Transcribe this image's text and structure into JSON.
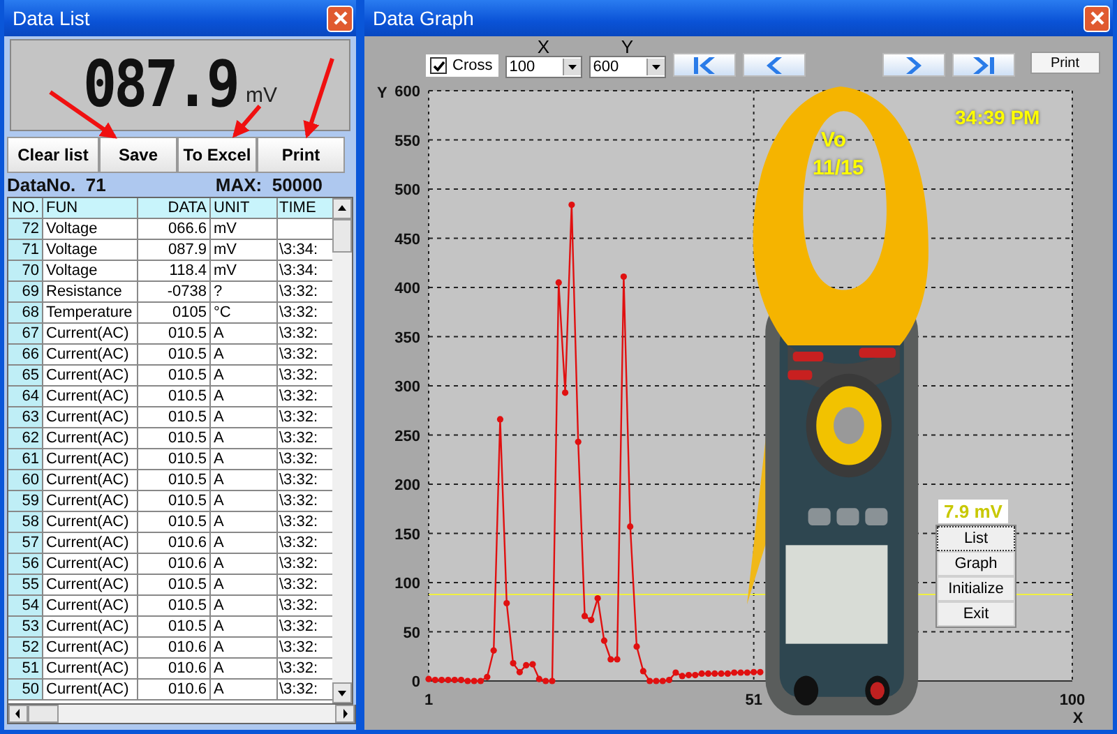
{
  "data_list": {
    "title": "Data List",
    "display": {
      "reading": "087.9",
      "unit": "mV"
    },
    "buttons": [
      "Clear list",
      "Save",
      "To Excel",
      "Print"
    ],
    "data_no_label": "DataNo.",
    "data_no": "71",
    "max_label": "MAX:",
    "max": "50000",
    "table": {
      "columns": [
        "NO.",
        "FUN",
        "DATA",
        "UNIT",
        "TIME"
      ],
      "rows": [
        {
          "no": "72",
          "fun": "Voltage",
          "data": "066.6",
          "unit": "mV"
        },
        {
          "no": "71",
          "fun": "Voltage",
          "data": "087.9",
          "unit": "mV",
          "time": "\\3:34:"
        },
        {
          "no": "70",
          "fun": "Voltage",
          "data": "118.4",
          "unit": "mV",
          "time": "\\3:34:"
        },
        {
          "no": "69",
          "fun": "Resistance",
          "data": "-0738",
          "unit": "?",
          "time": "\\3:32:"
        },
        {
          "no": "68",
          "fun": "Temperature",
          "data": "0105",
          "unit": "°C",
          "time": "\\3:32:"
        },
        {
          "no": "67",
          "fun": "Current(AC)",
          "data": "010.5",
          "unit": "A",
          "time": "\\3:32:"
        },
        {
          "no": "66",
          "fun": "Current(AC)",
          "data": "010.5",
          "unit": "A",
          "time": "\\3:32:"
        },
        {
          "no": "65",
          "fun": "Current(AC)",
          "data": "010.5",
          "unit": "A",
          "time": "\\3:32:"
        },
        {
          "no": "64",
          "fun": "Current(AC)",
          "data": "010.5",
          "unit": "A",
          "time": "\\3:32:"
        },
        {
          "no": "63",
          "fun": "Current(AC)",
          "data": "010.5",
          "unit": "A",
          "time": "\\3:32:"
        },
        {
          "no": "62",
          "fun": "Current(AC)",
          "data": "010.5",
          "unit": "A",
          "time": "\\3:32:"
        },
        {
          "no": "61",
          "fun": "Current(AC)",
          "data": "010.5",
          "unit": "A",
          "time": "\\3:32:"
        },
        {
          "no": "60",
          "fun": "Current(AC)",
          "data": "010.5",
          "unit": "A",
          "time": "\\3:32:"
        },
        {
          "no": "59",
          "fun": "Current(AC)",
          "data": "010.5",
          "unit": "A",
          "time": "\\3:32:"
        },
        {
          "no": "58",
          "fun": "Current(AC)",
          "data": "010.5",
          "unit": "A",
          "time": "\\3:32:"
        },
        {
          "no": "57",
          "fun": "Current(AC)",
          "data": "010.6",
          "unit": "A",
          "time": "\\3:32:"
        },
        {
          "no": "56",
          "fun": "Current(AC)",
          "data": "010.6",
          "unit": "A",
          "time": "\\3:32:"
        },
        {
          "no": "55",
          "fun": "Current(AC)",
          "data": "010.5",
          "unit": "A",
          "time": "\\3:32:"
        },
        {
          "no": "54",
          "fun": "Current(AC)",
          "data": "010.5",
          "unit": "A",
          "time": "\\3:32:"
        },
        {
          "no": "53",
          "fun": "Current(AC)",
          "data": "010.5",
          "unit": "A",
          "time": "\\3:32:"
        },
        {
          "no": "52",
          "fun": "Current(AC)",
          "data": "010.6",
          "unit": "A",
          "time": "\\3:32:"
        },
        {
          "no": "51",
          "fun": "Current(AC)",
          "data": "010.6",
          "unit": "A",
          "time": "\\3:32:"
        },
        {
          "no": "50",
          "fun": "Current(AC)",
          "data": "010.6",
          "unit": "A",
          "time": "\\3:32:"
        }
      ]
    }
  },
  "data_graph": {
    "title": "Data Graph",
    "cross": {
      "label": "Cross",
      "checked": true
    },
    "x_label": "X",
    "x_value": "100",
    "y_label": "Y",
    "y_value": "600",
    "print_button": "Print",
    "y_axis_label": "Y",
    "x_axis_label": "X",
    "overlay": {
      "series_name": "Vo",
      "date": "11/15",
      "time": "34:39 PM",
      "value_box": "7.9 mV"
    },
    "menu": [
      {
        "label": "List",
        "selected": true
      },
      {
        "label": "Graph",
        "selected": false
      },
      {
        "label": "Initialize",
        "selected": false
      },
      {
        "label": "Exit",
        "selected": false
      }
    ],
    "chart_data": {
      "type": "line",
      "grid": true,
      "x": [
        1,
        2,
        3,
        4,
        5,
        6,
        7,
        8,
        9,
        10,
        11,
        12,
        13,
        14,
        15,
        16,
        17,
        18,
        19,
        20,
        21,
        22,
        23,
        24,
        25,
        26,
        27,
        28,
        29,
        30,
        31,
        32,
        33,
        34,
        35,
        36,
        37,
        38,
        39,
        40,
        41,
        42,
        43,
        44,
        45,
        46,
        47,
        48,
        49,
        50,
        51,
        52
      ],
      "xlim": [
        1,
        100
      ],
      "ylim": [
        0,
        600
      ],
      "xticks": [
        1,
        51,
        100
      ],
      "yticks": [
        0,
        50,
        100,
        150,
        200,
        250,
        300,
        350,
        400,
        450,
        500,
        550,
        600
      ],
      "series": [
        {
          "color": "#e01010",
          "marker": "o",
          "values": [
            2,
            1,
            1,
            1,
            1,
            1,
            0,
            0,
            0,
            4,
            31,
            266,
            79,
            18,
            9,
            16,
            17,
            2,
            0,
            0,
            405,
            293,
            484,
            243,
            66,
            62,
            84,
            41,
            22,
            22,
            411,
            157,
            35,
            10,
            0,
            0,
            0,
            1,
            8.5,
            5,
            6,
            6,
            7.5,
            7.5,
            7.5,
            7.5,
            7.5,
            8.5,
            8.5,
            8.5,
            9,
            9
          ]
        }
      ],
      "ref_lines": [
        {
          "axis": "y",
          "value": 87.9,
          "color": "#f0f040"
        }
      ]
    }
  }
}
